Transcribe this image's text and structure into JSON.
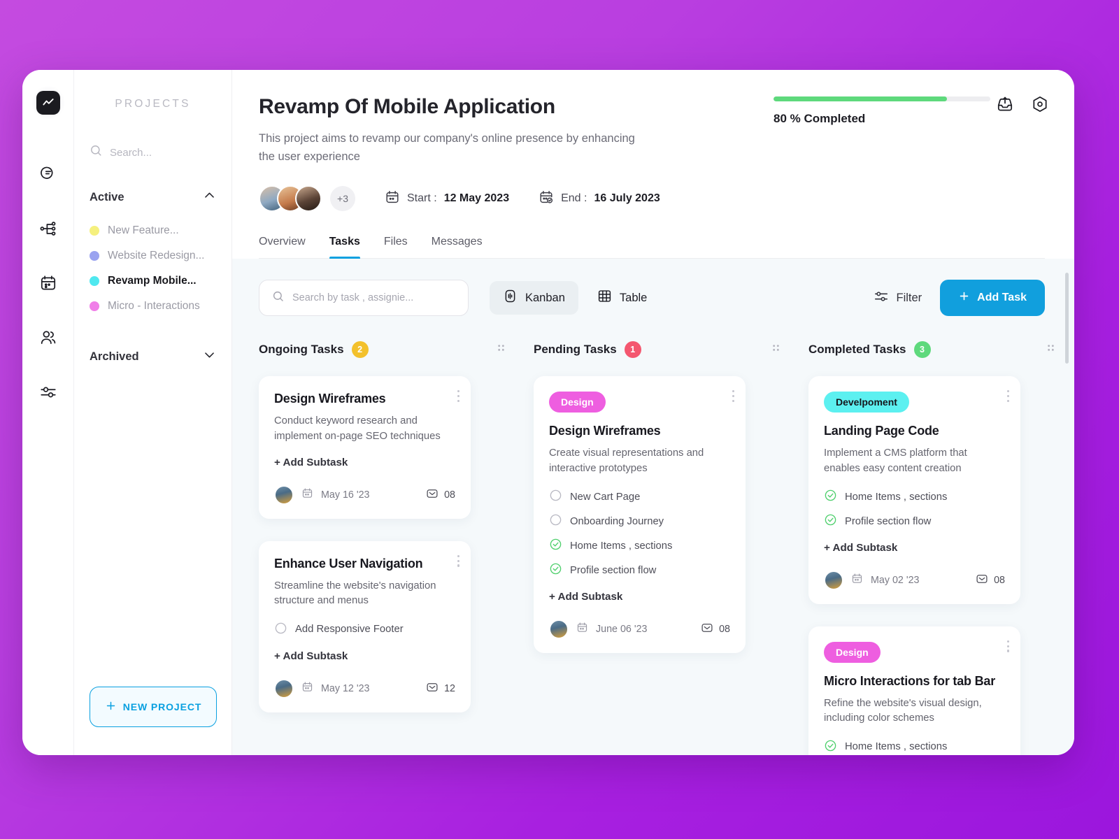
{
  "rail": {
    "logo_icon": "activity-logo-icon",
    "items": [
      {
        "icon": "chat-bubbles-icon",
        "active": false
      },
      {
        "icon": "project-tree-icon",
        "active": true
      },
      {
        "icon": "calendar-icon",
        "active": false
      },
      {
        "icon": "people-icon",
        "active": false
      },
      {
        "icon": "sliders-icon",
        "active": false
      }
    ]
  },
  "sidebar": {
    "title": "PROJECTS",
    "search_placeholder": "Search...",
    "active_group": {
      "label": "Active",
      "chevron": "chevron-up-icon"
    },
    "archived_group": {
      "label": "Archived",
      "chevron": "chevron-down-icon"
    },
    "projects": [
      {
        "name": "New Feature...",
        "color": "#f5f07e",
        "selected": false
      },
      {
        "name": "Website Redesign...",
        "color": "#9aa3f0",
        "selected": false
      },
      {
        "name": "Revamp Mobile...",
        "color": "#4fe8ef",
        "selected": true
      },
      {
        "name": "Micro - Interactions",
        "color": "#f07ee8",
        "selected": false
      }
    ],
    "new_project_label": "NEW PROJECT"
  },
  "header": {
    "title": "Revamp Of Mobile Application",
    "description": "This project aims to revamp our company's online presence by enhancing the user experience",
    "avatar_overflow": "+3",
    "start_label": "Start :",
    "start_value": "12 May 2023",
    "end_label": "End :",
    "end_value": "16 July 2023",
    "progress_percent": 80,
    "progress_text": "80 % Completed",
    "progress_color": "#5ed97c",
    "icons": [
      "inbox-download-icon",
      "settings-hexagon-icon"
    ],
    "tabs": [
      {
        "label": "Overview",
        "active": false
      },
      {
        "label": "Tasks",
        "active": true
      },
      {
        "label": "Files",
        "active": false
      },
      {
        "label": "Messages",
        "active": false
      }
    ]
  },
  "toolbar": {
    "search_placeholder": "Search by task , assignie...",
    "kanban_label": "Kanban",
    "table_label": "Table",
    "filter_label": "Filter",
    "add_task_label": "Add Task",
    "accent_color": "#119fdd"
  },
  "board": {
    "add_subtask_label": "+ Add Subtask",
    "columns": [
      {
        "title": "Ongoing Tasks",
        "count": "2",
        "badge_color": "#f3c12c",
        "cards": [
          {
            "tag": null,
            "title": "Design Wireframes",
            "desc": "Conduct keyword research and implement on-page SEO techniques",
            "subtasks": [],
            "date": "May 16 '23",
            "comments": "08"
          },
          {
            "tag": null,
            "title": "Enhance User Navigation",
            "desc": "Streamline the website's navigation structure and menus",
            "subtasks": [
              {
                "label": "Add Responsive Footer",
                "done": false
              }
            ],
            "date": "May 12 '23",
            "comments": "12"
          }
        ]
      },
      {
        "title": "Pending Tasks",
        "count": "1",
        "badge_color": "#f4576f",
        "cards": [
          {
            "tag": {
              "label": "Design",
              "bg": "#ee5ee0",
              "fg": "#ffffff"
            },
            "title": "Design Wireframes",
            "desc": "Create visual representations and interactive prototypes",
            "subtasks": [
              {
                "label": "New Cart Page",
                "done": false
              },
              {
                "label": "Onboarding Journey",
                "done": false
              },
              {
                "label": "Home Items , sections",
                "done": true
              },
              {
                "label": "Profile section flow",
                "done": true
              }
            ],
            "date": "June 06 '23",
            "comments": "08"
          }
        ]
      },
      {
        "title": "Completed Tasks",
        "count": "3",
        "badge_color": "#5ed97c",
        "cards": [
          {
            "tag": {
              "label": "Develpoment",
              "bg": "#5cf0f0",
              "fg": "#16161c"
            },
            "title": "Landing Page Code",
            "desc": "Implement a CMS platform that enables easy content creation",
            "subtasks": [
              {
                "label": "Home Items , sections",
                "done": true
              },
              {
                "label": "Profile section flow",
                "done": true
              }
            ],
            "date": "May 02 '23",
            "comments": "08"
          },
          {
            "tag": {
              "label": "Design",
              "bg": "#ee5ee0",
              "fg": "#ffffff"
            },
            "title": "Micro Interactions for tab Bar",
            "desc": "Refine the website's visual design, including color schemes",
            "subtasks": [
              {
                "label": "Home Items , sections",
                "done": true
              }
            ],
            "date": null,
            "comments": null
          }
        ]
      }
    ]
  }
}
